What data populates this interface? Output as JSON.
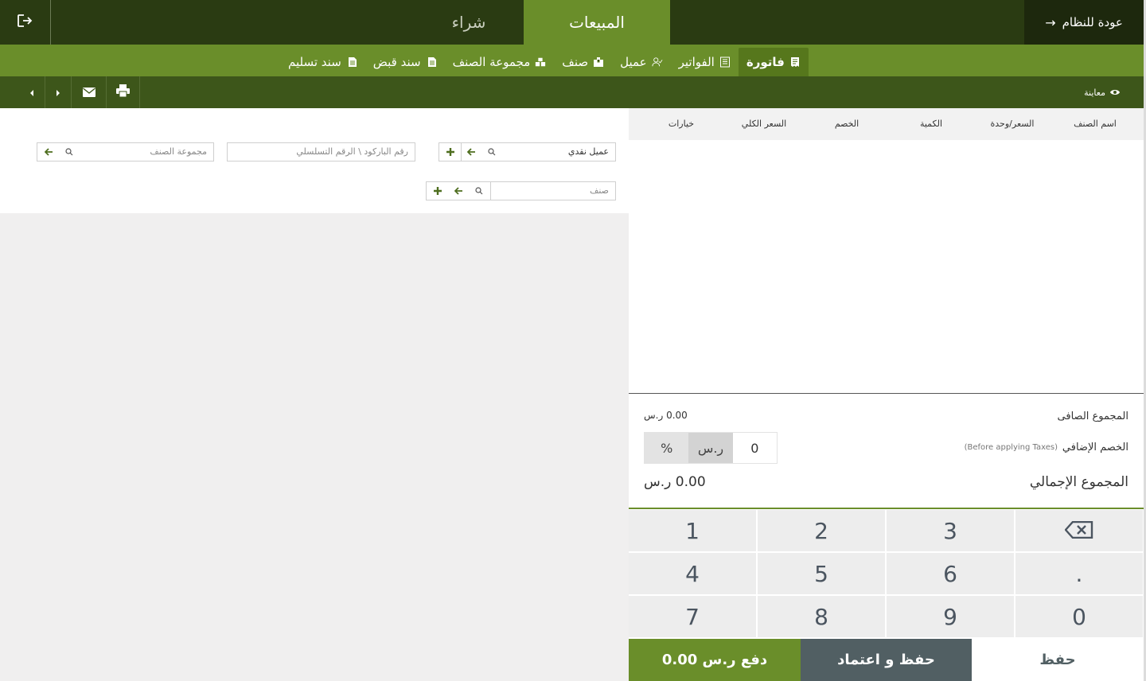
{
  "topbar": {
    "back_label": "عودة للنظام",
    "back_arrow": "→",
    "tab_sales": "المبيعات",
    "tab_buy": "شراء",
    "logout_icon": "logout-icon"
  },
  "subtabs": [
    {
      "label": "فاتورة",
      "icon": "receipt-icon",
      "active": true
    },
    {
      "label": "الفواتير",
      "icon": "list-icon",
      "active": false
    },
    {
      "label": "عميل",
      "icon": "user-check-icon",
      "active": false
    },
    {
      "label": "صنف",
      "icon": "box-icon",
      "active": false
    },
    {
      "label": "مجموعة الصنف",
      "icon": "boxes-icon",
      "active": false
    },
    {
      "label": "سند قبض",
      "icon": "document-icon",
      "active": false
    },
    {
      "label": "سند تسليم",
      "icon": "document-icon",
      "active": false
    }
  ],
  "toolbar": {
    "preview_label": "معاينة"
  },
  "table": {
    "headers": [
      "اسم الصنف",
      "السعر/وحدة",
      "الكمية",
      "الخصم",
      "السعر الكلي",
      "خيارات"
    ]
  },
  "summary": {
    "net_label": "المجموع الصافى",
    "net_value": "0.00 ر.س",
    "discount_label": "الخصم الإضافي",
    "discount_note": "(Before applying Taxes)",
    "discount_value": "0",
    "currency_option": "ر.س",
    "percent_option": "%",
    "total_label": "المجموع الإجمالي",
    "total_value": "0.00 ر.س"
  },
  "keypad": {
    "keys": [
      "1",
      "2",
      "3",
      "4",
      "5",
      "6",
      ".",
      "7",
      "8",
      "9",
      "0"
    ]
  },
  "actions": {
    "pay": "دفع ر.س 0.00",
    "save_approve": "حفظ و اعتماد",
    "save": "حفظ"
  },
  "form": {
    "customer_value": "عميل نقدي",
    "barcode_placeholder": "رقم الباركود \\ الرقم التسلسلي",
    "group_placeholder": "مجموعة الصنف",
    "item_placeholder": "صنف"
  },
  "colors": {
    "dark": "#2a3b12",
    "green": "#6a8e2a",
    "toolbar": "#3d561a",
    "slate": "#515f63"
  }
}
